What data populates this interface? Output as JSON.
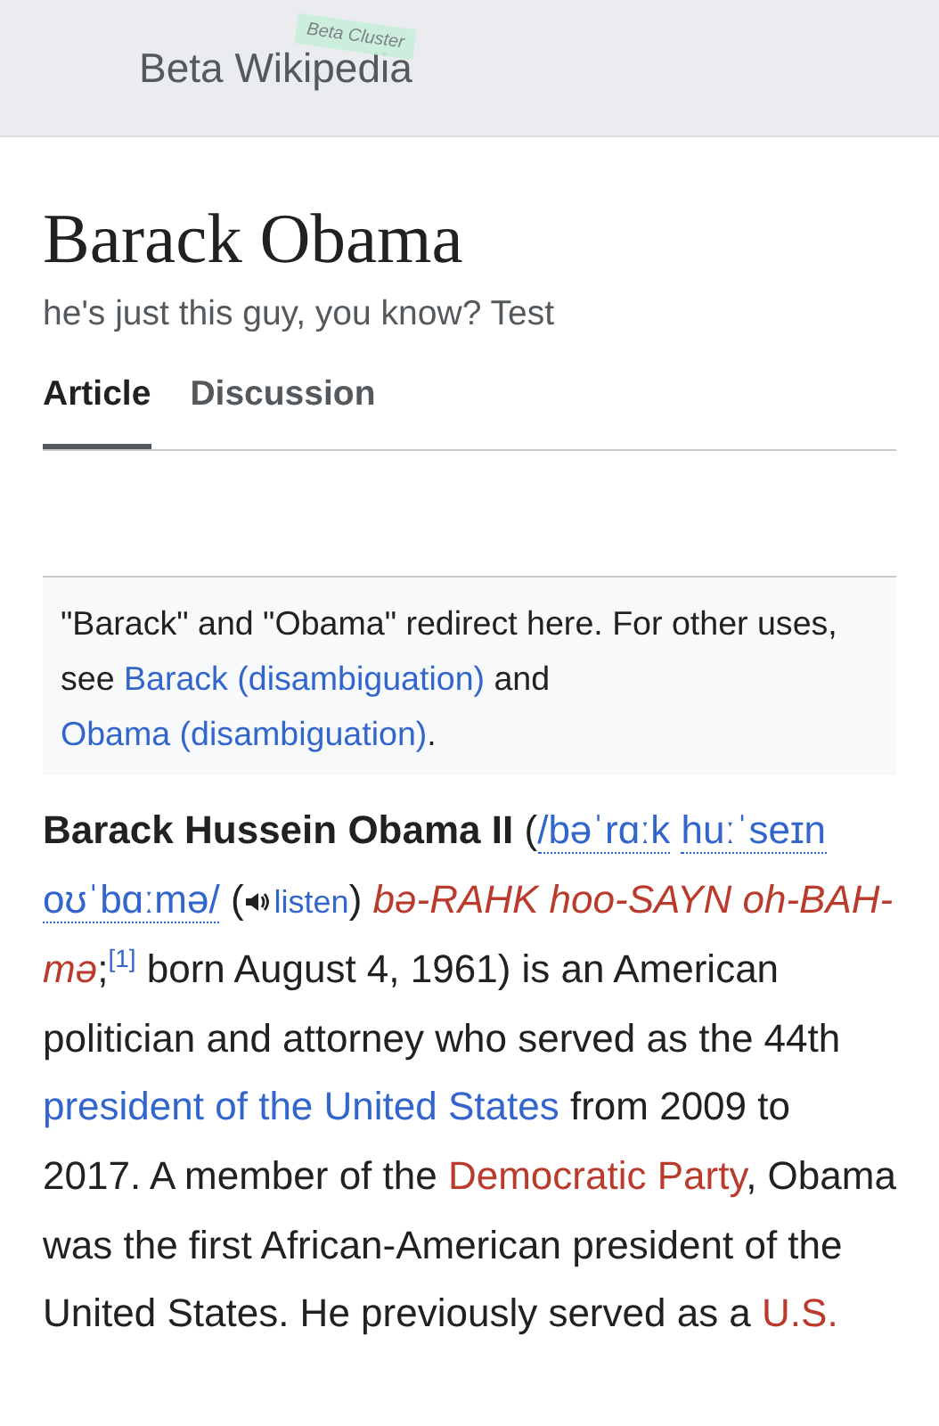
{
  "header": {
    "site_name": "Beta Wikipedia",
    "badge": "Beta Cluster"
  },
  "title": "Barack Obama",
  "tagline": "he's just this guy, you know? Test",
  "tabs": [
    {
      "label": "Article",
      "selected": true
    },
    {
      "label": "Discussion",
      "selected": false
    }
  ],
  "hatnote": [
    {
      "kind": "text",
      "text": "\"Barack\" and \"Obama\" redirect here. For other uses, see "
    },
    {
      "kind": "link",
      "text": "Barack (disambiguation)"
    },
    {
      "kind": "text",
      "text": " and "
    },
    {
      "kind": "link",
      "text": "Obama (disambiguation)"
    },
    {
      "kind": "text",
      "text": "."
    }
  ],
  "paragraph": [
    {
      "kind": "bold",
      "text": "Barack Hussein Obama II"
    },
    {
      "kind": "text",
      "text": " ("
    },
    {
      "kind": "ipa",
      "words": [
        "/bəˈrɑːk",
        "huːˈseɪn",
        "oʊˈbɑːmə/"
      ]
    },
    {
      "kind": "text",
      "text": " ("
    },
    {
      "kind": "listen",
      "text": "listen"
    },
    {
      "kind": "text",
      "text": ") "
    },
    {
      "kind": "respell",
      "text": "bə-RAHK hoo-SAYN oh-BAH-mə"
    },
    {
      "kind": "text",
      "text": ";"
    },
    {
      "kind": "ref",
      "text": "[1]"
    },
    {
      "kind": "text",
      "text": " born August 4, 1961) is an American politician and attorney who served as the 44th "
    },
    {
      "kind": "link",
      "text": "president of the United States"
    },
    {
      "kind": "text",
      "text": " from 2009 to 2017. A member of the "
    },
    {
      "kind": "redlink",
      "text": "Democratic Party"
    },
    {
      "kind": "text",
      "text": ", Obama was the first African-American president of the United States. He previously served as a "
    },
    {
      "kind": "redlink",
      "text": "U.S."
    }
  ]
}
